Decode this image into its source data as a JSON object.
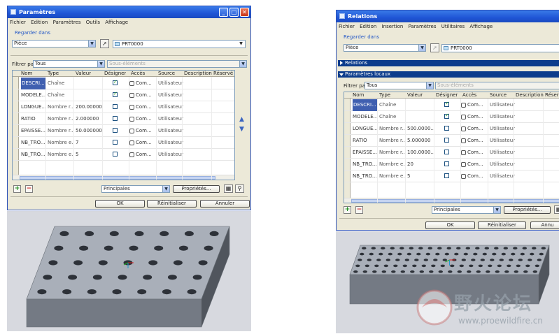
{
  "left_dialog": {
    "title": "Paramètres",
    "menu": [
      "Fichier",
      "Edition",
      "Paramètres",
      "Outils",
      "Affichage"
    ],
    "look_in_label": "Regarder dans",
    "scope_value": "Pièce",
    "model_value": "PRT0000",
    "filter_label": "Filtrer par",
    "filter_value": "Tous",
    "subelements_label": "Sous-éléments",
    "columns": [
      "Nom",
      "Type",
      "Valeur",
      "Désigner",
      "Accès",
      "Source",
      "Description",
      "Réservé"
    ],
    "rows": [
      {
        "name": "DESCRI...",
        "type": "Chaîne",
        "value": "",
        "designate": true,
        "access": "Com...",
        "source": "Utilisateur"
      },
      {
        "name": "MODELE...",
        "type": "Chaîne",
        "value": "",
        "designate": true,
        "access": "Com...",
        "source": "Utilisateur"
      },
      {
        "name": "LONGUE...",
        "type": "Nombre r...",
        "value": "200.00000...",
        "designate": false,
        "access": "Com...",
        "source": "Utilisateur"
      },
      {
        "name": "RATIO",
        "type": "Nombre r...",
        "value": "2.000000",
        "designate": false,
        "access": "Com...",
        "source": "Utilisateur"
      },
      {
        "name": "EPAISSE...",
        "type": "Nombre r...",
        "value": "50.000000",
        "designate": false,
        "access": "Com...",
        "source": "Utilisateur"
      },
      {
        "name": "NB_TRO...",
        "type": "Nombre e...",
        "value": "7",
        "designate": false,
        "access": "Com...",
        "source": "Utilisateur"
      },
      {
        "name": "NB_TRO...",
        "type": "Nombre e...",
        "value": "5",
        "designate": false,
        "access": "Com...",
        "source": "Utilisateur"
      }
    ],
    "param_set": "Principales",
    "properties_label": "Propriétés...",
    "ok_label": "OK",
    "reset_label": "Réinitialiser",
    "cancel_label": "Annuler"
  },
  "right_dialog": {
    "title": "Relations",
    "menu": [
      "Fichier",
      "Edition",
      "Insertion",
      "Paramètres",
      "Utilitaires",
      "Affichage"
    ],
    "look_in_label": "Regarder dans",
    "scope_value": "Pièce",
    "model_value": "PRT0000",
    "relations_bar": "Relations",
    "local_params_bar": "Paramètres locaux",
    "filter_label": "Filtrer par",
    "filter_value": "Tous",
    "subelements_label": "Sous-éléments",
    "columns": [
      "Nom",
      "Type",
      "Valeur",
      "Désigner",
      "Accès",
      "Source",
      "Description",
      "Réservé"
    ],
    "rows": [
      {
        "name": "DESCRI...",
        "type": "Chaîne",
        "value": "",
        "designate": true,
        "access": "Com...",
        "source": "Utilisateur"
      },
      {
        "name": "MODELE...",
        "type": "Chaîne",
        "value": "",
        "designate": true,
        "access": "Com...",
        "source": "Utilisateur"
      },
      {
        "name": "LONGUE...",
        "type": "Nombre r...",
        "value": "500.0000...",
        "designate": false,
        "access": "Com...",
        "source": "Utilisateur"
      },
      {
        "name": "RATIO",
        "type": "Nombre r...",
        "value": "5.000000",
        "designate": false,
        "access": "Com...",
        "source": "Utilisateur"
      },
      {
        "name": "EPAISSE...",
        "type": "Nombre r...",
        "value": "100.0000...",
        "designate": false,
        "access": "Com...",
        "source": "Utilisateur"
      },
      {
        "name": "NB_TRO...",
        "type": "Nombre e...",
        "value": "20",
        "designate": false,
        "access": "Com...",
        "source": "Utilisateur"
      },
      {
        "name": "NB_TRO...",
        "type": "Nombre e...",
        "value": "5",
        "designate": false,
        "access": "Com...",
        "source": "Utilisateur"
      }
    ],
    "param_set": "Principales",
    "properties_label": "Propriétés...",
    "ok_label": "OK",
    "reset_label": "Réinitialiser",
    "cancel_label": "Annu"
  },
  "left_block": {
    "hole_columns": 7,
    "hole_rows": 5
  },
  "right_block": {
    "hole_columns": 20,
    "hole_rows": 5
  },
  "watermark": {
    "title": "野火论坛",
    "url": "www.proewildfire.cn"
  },
  "icons": {
    "window": "window-icon",
    "pointer": "pointer-icon",
    "table": "table-icon",
    "binoculars": "binoculars-icon"
  }
}
